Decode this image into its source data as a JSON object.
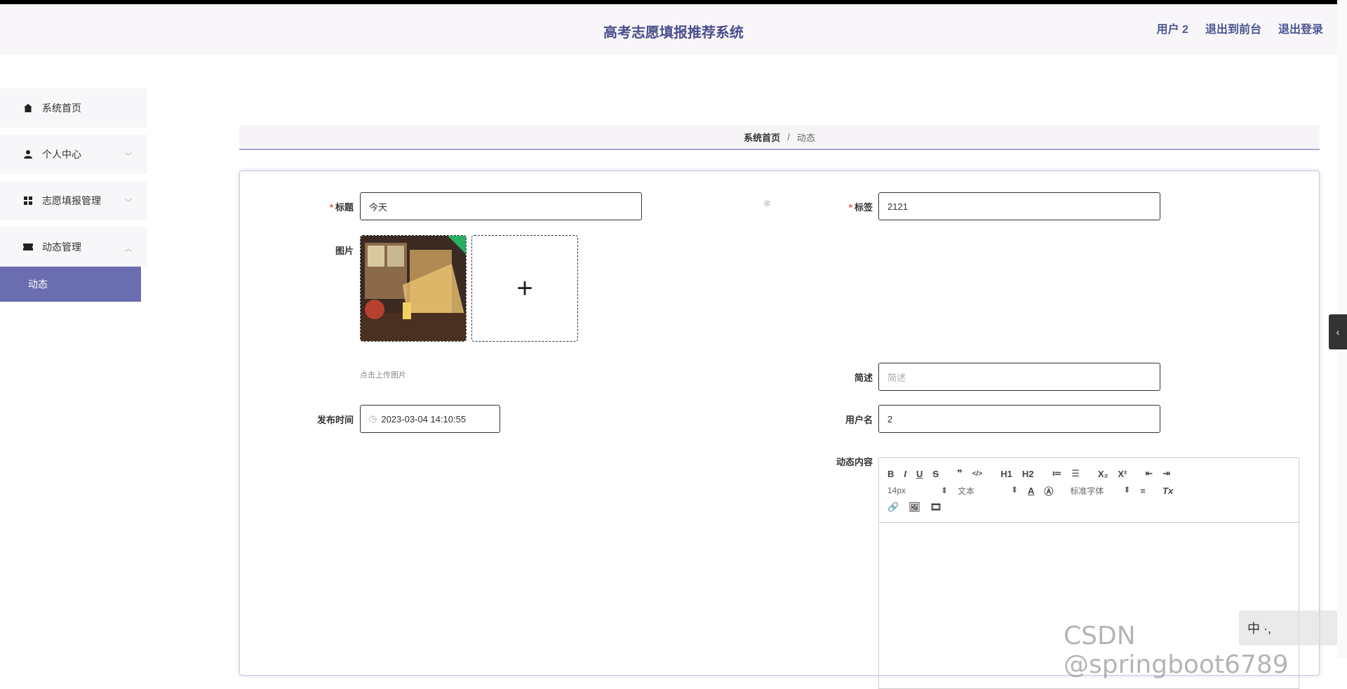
{
  "header": {
    "title": "高考志愿填报推荐系统",
    "user": "用户 2",
    "exit_front": "退出到前台",
    "logout": "退出登录"
  },
  "sidebar": {
    "items": [
      {
        "label": "系统首页",
        "icon": "home-icon"
      },
      {
        "label": "个人中心",
        "icon": "user-icon"
      },
      {
        "label": "志愿填报管理",
        "icon": "grid-icon"
      },
      {
        "label": "动态管理",
        "icon": "ticket-icon"
      }
    ],
    "sub_active": "动态"
  },
  "breadcrumb": {
    "home": "系统首页",
    "separator": "/",
    "current": "动态"
  },
  "form": {
    "title_label": "标题",
    "title_value": "今天",
    "tag_label": "标签",
    "tag_value": "2121",
    "image_label": "图片",
    "upload_plus": "+",
    "upload_hint": "点击上传图片",
    "summary_label": "简述",
    "summary_placeholder": "简述",
    "time_label": "发布时间",
    "time_value": "2023-03-04 14:10:55",
    "username_label": "用户名",
    "username_value": "2",
    "content_label": "动态内容"
  },
  "editor": {
    "font_size": "14px",
    "paragraph": "文本",
    "font_family": "标准字体",
    "tools_row1": [
      "B",
      "I",
      "U",
      "S",
      "❞",
      "</>",
      "H1",
      "H2",
      "≔",
      "☰",
      "X₂",
      "X²",
      "⇤",
      "⇥"
    ],
    "tools_row2": [
      "A",
      "Ⓐ",
      "≡",
      "Tx"
    ],
    "tools_row3": [
      "link",
      "image",
      "video"
    ]
  },
  "overlay": {
    "watermark": "CSDN @springboot6789",
    "ime": "中 ·,"
  },
  "colors": {
    "accent": "#6a6db0",
    "header_title": "#4a4f8c"
  }
}
